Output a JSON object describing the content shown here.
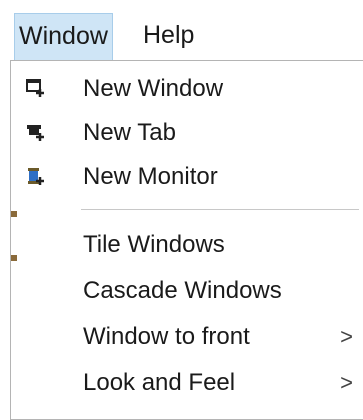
{
  "menubar": {
    "items": [
      {
        "label": "Window",
        "active": true
      },
      {
        "label": "Help",
        "active": false
      }
    ]
  },
  "window_menu": {
    "group1": [
      {
        "label": "New Window",
        "icon": "new-window-icon"
      },
      {
        "label": "New Tab",
        "icon": "new-tab-icon"
      },
      {
        "label": "New Monitor",
        "icon": "new-monitor-icon"
      }
    ],
    "group2": [
      {
        "label": "Tile Windows"
      },
      {
        "label": "Cascade Windows"
      },
      {
        "label": "Window to front",
        "submenu": true
      },
      {
        "label": "Look and Feel",
        "submenu": true
      }
    ],
    "submenu_glyph": ">"
  },
  "colors": {
    "active_menu_bg": "#cfe5f6",
    "active_menu_border": "#a8cdea",
    "menu_border": "#b4b4b4"
  }
}
